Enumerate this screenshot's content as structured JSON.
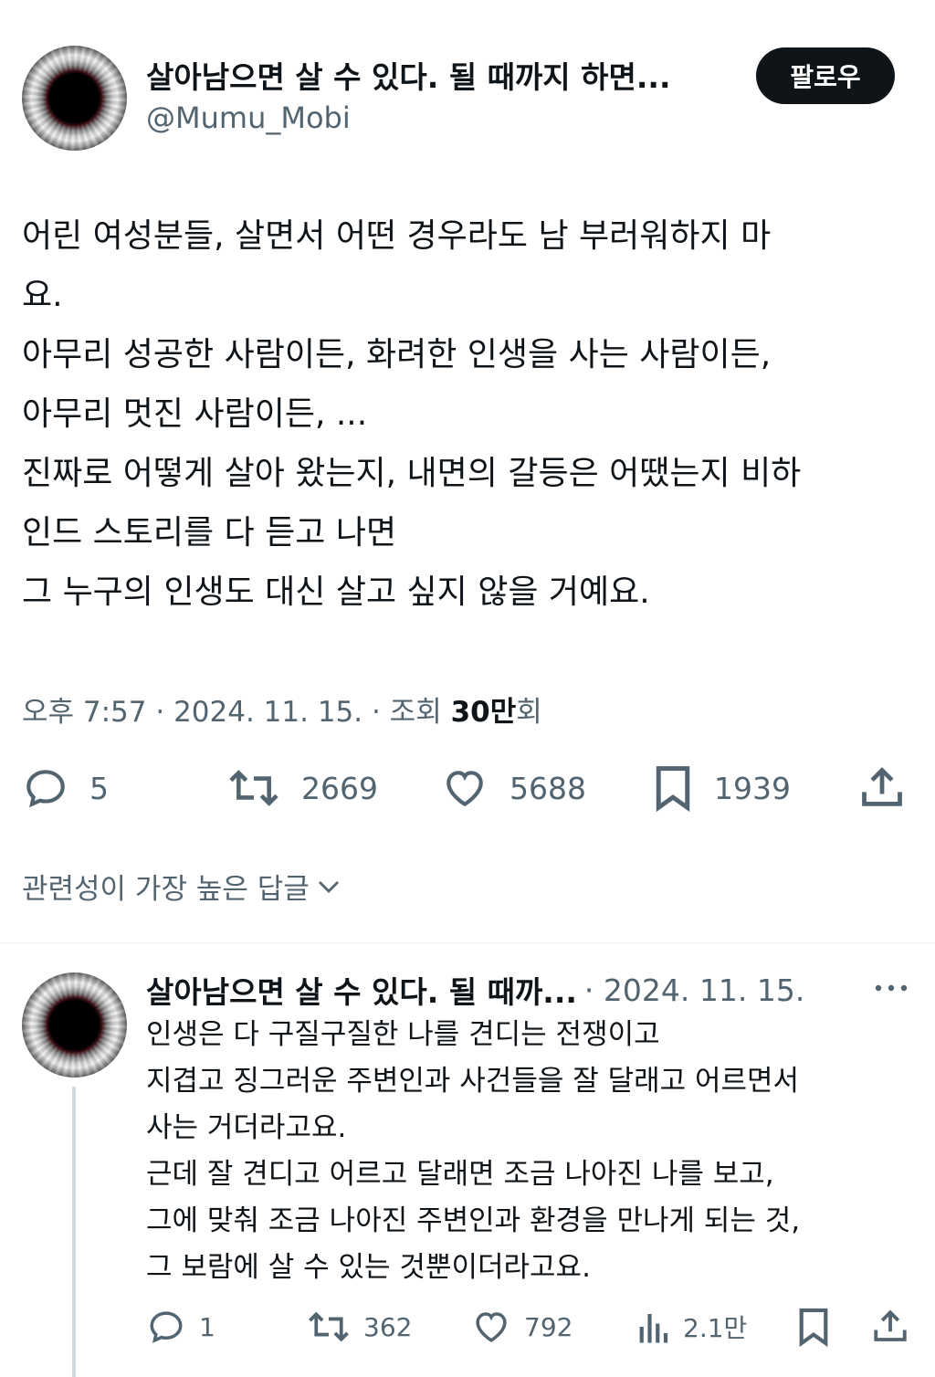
{
  "tweet": {
    "author_name": "살아남으면 살 수 있다. 될 때까지 하면...",
    "author_handle": "@Mumu_Mobi",
    "follow_label": "팔로우",
    "lines": [
      "어린 여성분들, 살면서 어떤 경우라도 남 부러워하지 마",
      "요.",
      "아무리 성공한 사람이든, 화려한 인생을 사는 사람이든,",
      "아무리 멋진 사람이든, ...",
      "진짜로 어떻게 살아 왔는지, 내면의 갈등은 어땠는지 비하",
      "인드 스토리를 다 듣고 나면",
      "그 누구의 인생도 대신 살고 싶지 않을 거예요."
    ],
    "meta_time": "오후 7:57 · 2024. 11. 15. · 조회 ",
    "meta_views_number": "30만",
    "meta_views_suffix": "회",
    "actions": {
      "reply_count": "5",
      "retweet_count": "2669",
      "like_count": "5688",
      "bookmark_count": "1939"
    }
  },
  "replies_sort_label": "관련성이 가장 높은 답글",
  "reply": {
    "author_name": "살아남으면 살 수 있다. 될 때까...",
    "date": "· 2024. 11. 15.",
    "lines": [
      "인생은 다 구질구질한 나를 견디는 전쟁이고",
      "지겹고 징그러운 주변인과 사건들을 잘 달래고 어르면서",
      "사는 거더라고요.",
      "근데 잘 견디고 어르고 달래면 조금 나아진 나를 보고,",
      "그에 맞춰 조금 나아진 주변인과 환경을 만나게 되는 것,",
      "그 보람에 살 수 있는 것뿐이더라고요."
    ],
    "actions": {
      "reply_count": "1",
      "retweet_count": "362",
      "like_count": "792",
      "views_count": "2.1만"
    }
  },
  "icons": {
    "reply": "speech-bubble-icon",
    "retweet": "retweet-icon",
    "like": "heart-icon",
    "bookmark": "bookmark-icon",
    "share": "share-icon",
    "views": "bar-chart-icon",
    "more": "more-dots-icon",
    "chevron": "chevron-down-icon"
  },
  "colors": {
    "text_primary": "#0f1419",
    "text_secondary": "#536471",
    "follow_button_bg": "#0f1419",
    "divider": "#eff3f4"
  }
}
